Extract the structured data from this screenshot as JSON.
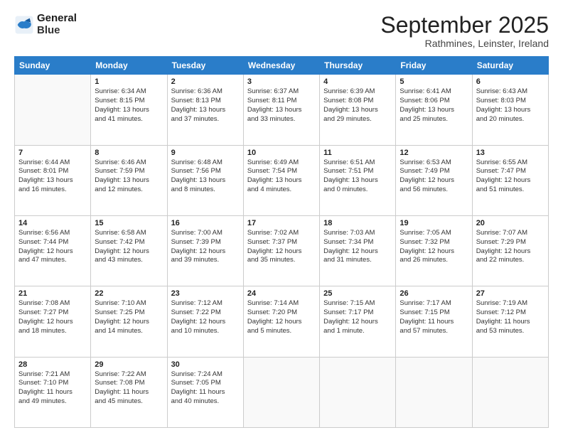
{
  "logo": {
    "line1": "General",
    "line2": "Blue"
  },
  "title": "September 2025",
  "subtitle": "Rathmines, Leinster, Ireland",
  "days_of_week": [
    "Sunday",
    "Monday",
    "Tuesday",
    "Wednesday",
    "Thursday",
    "Friday",
    "Saturday"
  ],
  "weeks": [
    [
      {
        "day": "",
        "info": ""
      },
      {
        "day": "1",
        "info": "Sunrise: 6:34 AM\nSunset: 8:15 PM\nDaylight: 13 hours\nand 41 minutes."
      },
      {
        "day": "2",
        "info": "Sunrise: 6:36 AM\nSunset: 8:13 PM\nDaylight: 13 hours\nand 37 minutes."
      },
      {
        "day": "3",
        "info": "Sunrise: 6:37 AM\nSunset: 8:11 PM\nDaylight: 13 hours\nand 33 minutes."
      },
      {
        "day": "4",
        "info": "Sunrise: 6:39 AM\nSunset: 8:08 PM\nDaylight: 13 hours\nand 29 minutes."
      },
      {
        "day": "5",
        "info": "Sunrise: 6:41 AM\nSunset: 8:06 PM\nDaylight: 13 hours\nand 25 minutes."
      },
      {
        "day": "6",
        "info": "Sunrise: 6:43 AM\nSunset: 8:03 PM\nDaylight: 13 hours\nand 20 minutes."
      }
    ],
    [
      {
        "day": "7",
        "info": "Sunrise: 6:44 AM\nSunset: 8:01 PM\nDaylight: 13 hours\nand 16 minutes."
      },
      {
        "day": "8",
        "info": "Sunrise: 6:46 AM\nSunset: 7:59 PM\nDaylight: 13 hours\nand 12 minutes."
      },
      {
        "day": "9",
        "info": "Sunrise: 6:48 AM\nSunset: 7:56 PM\nDaylight: 13 hours\nand 8 minutes."
      },
      {
        "day": "10",
        "info": "Sunrise: 6:49 AM\nSunset: 7:54 PM\nDaylight: 13 hours\nand 4 minutes."
      },
      {
        "day": "11",
        "info": "Sunrise: 6:51 AM\nSunset: 7:51 PM\nDaylight: 13 hours\nand 0 minutes."
      },
      {
        "day": "12",
        "info": "Sunrise: 6:53 AM\nSunset: 7:49 PM\nDaylight: 12 hours\nand 56 minutes."
      },
      {
        "day": "13",
        "info": "Sunrise: 6:55 AM\nSunset: 7:47 PM\nDaylight: 12 hours\nand 51 minutes."
      }
    ],
    [
      {
        "day": "14",
        "info": "Sunrise: 6:56 AM\nSunset: 7:44 PM\nDaylight: 12 hours\nand 47 minutes."
      },
      {
        "day": "15",
        "info": "Sunrise: 6:58 AM\nSunset: 7:42 PM\nDaylight: 12 hours\nand 43 minutes."
      },
      {
        "day": "16",
        "info": "Sunrise: 7:00 AM\nSunset: 7:39 PM\nDaylight: 12 hours\nand 39 minutes."
      },
      {
        "day": "17",
        "info": "Sunrise: 7:02 AM\nSunset: 7:37 PM\nDaylight: 12 hours\nand 35 minutes."
      },
      {
        "day": "18",
        "info": "Sunrise: 7:03 AM\nSunset: 7:34 PM\nDaylight: 12 hours\nand 31 minutes."
      },
      {
        "day": "19",
        "info": "Sunrise: 7:05 AM\nSunset: 7:32 PM\nDaylight: 12 hours\nand 26 minutes."
      },
      {
        "day": "20",
        "info": "Sunrise: 7:07 AM\nSunset: 7:29 PM\nDaylight: 12 hours\nand 22 minutes."
      }
    ],
    [
      {
        "day": "21",
        "info": "Sunrise: 7:08 AM\nSunset: 7:27 PM\nDaylight: 12 hours\nand 18 minutes."
      },
      {
        "day": "22",
        "info": "Sunrise: 7:10 AM\nSunset: 7:25 PM\nDaylight: 12 hours\nand 14 minutes."
      },
      {
        "day": "23",
        "info": "Sunrise: 7:12 AM\nSunset: 7:22 PM\nDaylight: 12 hours\nand 10 minutes."
      },
      {
        "day": "24",
        "info": "Sunrise: 7:14 AM\nSunset: 7:20 PM\nDaylight: 12 hours\nand 5 minutes."
      },
      {
        "day": "25",
        "info": "Sunrise: 7:15 AM\nSunset: 7:17 PM\nDaylight: 12 hours\nand 1 minute."
      },
      {
        "day": "26",
        "info": "Sunrise: 7:17 AM\nSunset: 7:15 PM\nDaylight: 11 hours\nand 57 minutes."
      },
      {
        "day": "27",
        "info": "Sunrise: 7:19 AM\nSunset: 7:12 PM\nDaylight: 11 hours\nand 53 minutes."
      }
    ],
    [
      {
        "day": "28",
        "info": "Sunrise: 7:21 AM\nSunset: 7:10 PM\nDaylight: 11 hours\nand 49 minutes."
      },
      {
        "day": "29",
        "info": "Sunrise: 7:22 AM\nSunset: 7:08 PM\nDaylight: 11 hours\nand 45 minutes."
      },
      {
        "day": "30",
        "info": "Sunrise: 7:24 AM\nSunset: 7:05 PM\nDaylight: 11 hours\nand 40 minutes."
      },
      {
        "day": "",
        "info": ""
      },
      {
        "day": "",
        "info": ""
      },
      {
        "day": "",
        "info": ""
      },
      {
        "day": "",
        "info": ""
      }
    ]
  ]
}
